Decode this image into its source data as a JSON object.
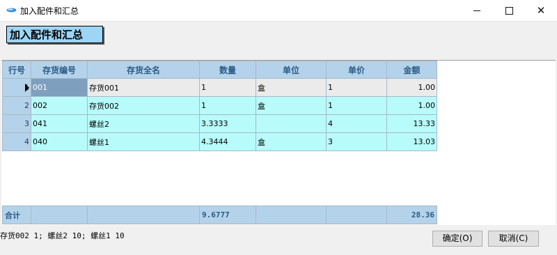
{
  "window": {
    "title": "加入配件和汇总",
    "icon": "app-icon",
    "minimize_glyph": "—",
    "close_glyph": "✕"
  },
  "header": {
    "label": "加入配件和汇总"
  },
  "grid": {
    "columns": [
      "行号",
      "存货编号",
      "存货全名",
      "数量",
      "单位",
      "单价",
      "金额"
    ],
    "rows": [
      {
        "no": "1",
        "code": "001",
        "name": "存货001",
        "qty": "1",
        "unit": "盒",
        "price": "1",
        "amount": "1.00"
      },
      {
        "no": "2",
        "code": "002",
        "name": "存货002",
        "qty": "1",
        "unit": "盒",
        "price": "1",
        "amount": "1.00"
      },
      {
        "no": "3",
        "code": "041",
        "name": "螺丝2",
        "qty": "3.3333",
        "unit": "",
        "price": "4",
        "amount": "13.33"
      },
      {
        "no": "4",
        "code": "040",
        "name": "螺丝1",
        "qty": "4.3444",
        "unit": "盒",
        "price": "3",
        "amount": "13.03"
      }
    ]
  },
  "totals": {
    "label": "合计",
    "qty": "9.6777",
    "amount": "28.36"
  },
  "summary": "存货002 1; 螺丝2 10; 螺丝1 10",
  "buttons": {
    "ok": "确定(O)",
    "cancel": "取消(C)"
  },
  "colors": {
    "header_bg": "#b4d3ea",
    "row_bg": "#b8fbfb",
    "selected_row_bg": "#ebebeb",
    "active_cell_bg": "#7f9fbf",
    "badge_bg": "#9dd5f6"
  }
}
